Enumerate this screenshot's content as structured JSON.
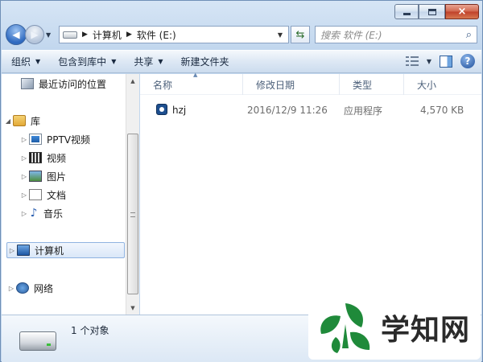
{
  "window": {
    "caption_buttons": {
      "minimize": "minimize",
      "maximize": "maximize",
      "close": "×"
    }
  },
  "address": {
    "crumbs": [
      "计算机",
      "软件 (E:)"
    ],
    "search_placeholder": "搜索 软件 (E:)"
  },
  "toolbar": {
    "organize": "组织",
    "include_in_library": "包含到库中",
    "share": "共享",
    "new_folder": "新建文件夹"
  },
  "nav": {
    "recent": "最近访问的位置",
    "library": "库",
    "library_items": [
      "PPTV视频",
      "视频",
      "图片",
      "文档",
      "音乐"
    ],
    "computer": "计算机",
    "network": "网络"
  },
  "columns": {
    "name": "名称",
    "modified": "修改日期",
    "type": "类型",
    "size": "大小"
  },
  "files": [
    {
      "name": "hzj",
      "modified": "2016/12/9 11:26",
      "type": "应用程序",
      "size": "4,570 KB"
    }
  ],
  "details": {
    "item_count": "1 个对象"
  },
  "watermark": {
    "text": "学知网"
  },
  "colors": {
    "accent": "#2f6ac0",
    "selection": "#dae7f8",
    "logo_green": "#1f8a3a"
  }
}
